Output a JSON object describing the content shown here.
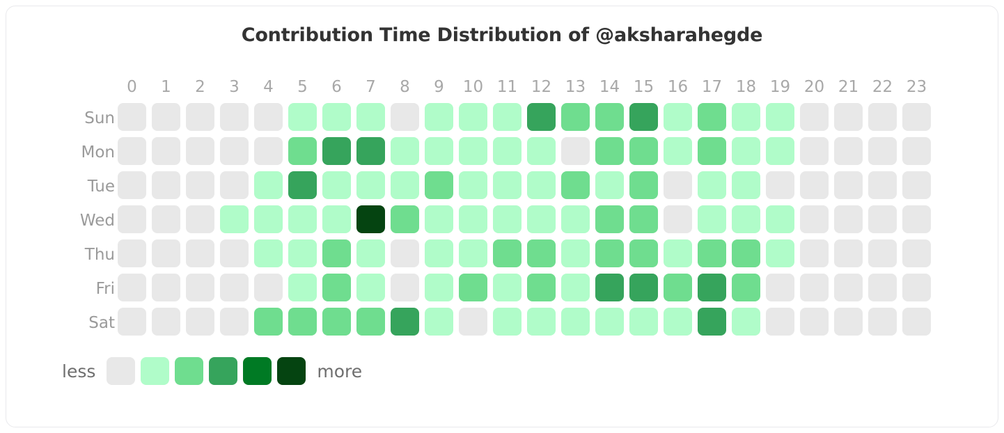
{
  "title": "Contribution Time Distribution of @aksharahegde",
  "legend": {
    "less_label": "less",
    "more_label": "more",
    "levels": [
      "#e8e8e8",
      "#b0fcc9",
      "#6fdd8f",
      "#36a45c",
      "#007a24",
      "#054411"
    ]
  },
  "chart_data": {
    "type": "heatmap",
    "title": "Contribution Time Distribution of @aksharahegde",
    "xlabel": "",
    "ylabel": "",
    "x_tick_labels": [
      "0",
      "1",
      "2",
      "3",
      "4",
      "5",
      "6",
      "7",
      "8",
      "9",
      "10",
      "11",
      "12",
      "13",
      "14",
      "15",
      "16",
      "17",
      "18",
      "19",
      "20",
      "21",
      "22",
      "23"
    ],
    "y_tick_labels": [
      "Sun",
      "Mon",
      "Tue",
      "Wed",
      "Thu",
      "Fri",
      "Sat"
    ],
    "colorscale": [
      "#e8e8e8",
      "#b0fcc9",
      "#6fdd8f",
      "#36a45c",
      "#007a24",
      "#054411"
    ],
    "level_min": 0,
    "level_max": 5,
    "legend_position": "bottom-left",
    "grid": false,
    "rows": [
      {
        "day": "Sun",
        "values": [
          0,
          0,
          0,
          0,
          0,
          1,
          1,
          1,
          0,
          1,
          1,
          1,
          3,
          2,
          2,
          3,
          1,
          2,
          1,
          1,
          0,
          0,
          0,
          0
        ]
      },
      {
        "day": "Mon",
        "values": [
          0,
          0,
          0,
          0,
          0,
          2,
          3,
          3,
          1,
          1,
          1,
          1,
          1,
          0,
          2,
          2,
          1,
          2,
          1,
          1,
          0,
          0,
          0,
          0
        ]
      },
      {
        "day": "Tue",
        "values": [
          0,
          0,
          0,
          0,
          1,
          3,
          1,
          1,
          1,
          2,
          1,
          1,
          1,
          2,
          1,
          2,
          0,
          1,
          1,
          0,
          0,
          0,
          0,
          0
        ]
      },
      {
        "day": "Wed",
        "values": [
          0,
          0,
          0,
          1,
          1,
          1,
          1,
          5,
          2,
          1,
          1,
          1,
          1,
          1,
          2,
          2,
          0,
          1,
          1,
          1,
          0,
          0,
          0,
          0
        ]
      },
      {
        "day": "Thu",
        "values": [
          0,
          0,
          0,
          0,
          1,
          1,
          2,
          1,
          0,
          1,
          1,
          2,
          2,
          1,
          2,
          2,
          1,
          2,
          2,
          1,
          0,
          0,
          0,
          0
        ]
      },
      {
        "day": "Fri",
        "values": [
          0,
          0,
          0,
          0,
          0,
          1,
          2,
          1,
          0,
          1,
          2,
          1,
          2,
          1,
          3,
          3,
          2,
          3,
          2,
          0,
          0,
          0,
          0,
          0
        ]
      },
      {
        "day": "Sat",
        "values": [
          0,
          0,
          0,
          0,
          2,
          2,
          2,
          2,
          3,
          1,
          0,
          1,
          1,
          1,
          1,
          1,
          1,
          3,
          1,
          0,
          0,
          0,
          0,
          0
        ]
      }
    ]
  }
}
